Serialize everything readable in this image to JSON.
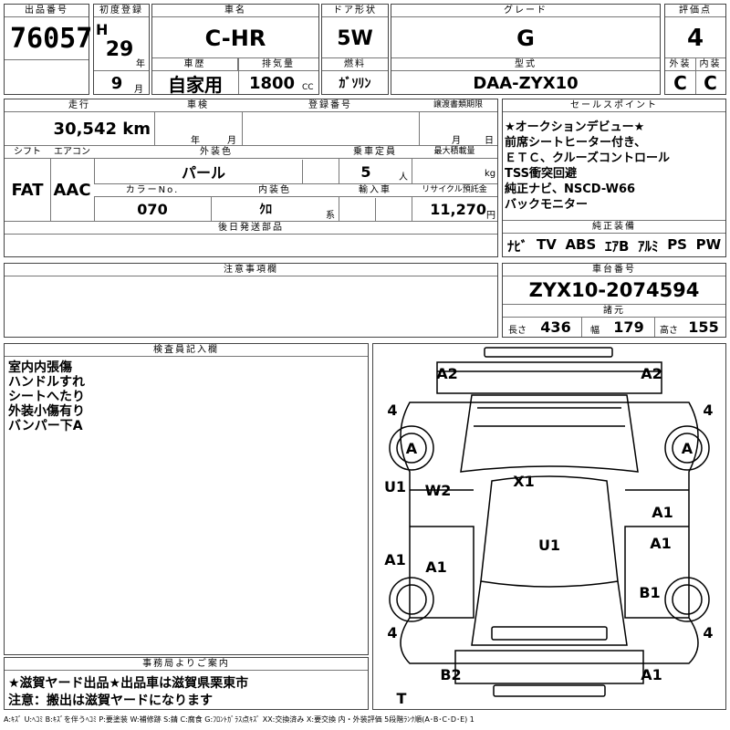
{
  "header": {
    "lot_no_label": "出品番号",
    "lot_no": "76057",
    "first_reg_label": "初度登録",
    "era": "H",
    "year": "29",
    "year_unit": "年",
    "month": "9",
    "month_unit": "月",
    "name_label": "車名",
    "name": "C-HR",
    "history_label": "車歴",
    "history": "自家用",
    "displacement_label": "排気量",
    "displacement": "1800",
    "displacement_unit": "CC",
    "door_label": "ドア形状",
    "door": "5W",
    "fuel_label": "燃料",
    "fuel": "ｶﾞｿﾘﾝ",
    "grade_label": "グレード",
    "grade": "G",
    "model_label": "型式",
    "model": "DAA-ZYX10",
    "score_label": "評価点",
    "score": "4",
    "ext_label": "外装",
    "ext": "C",
    "int_label": "内装",
    "int": "C"
  },
  "row2": {
    "mileage_label": "走行",
    "mileage": "30,542 km",
    "inspection_label": "車検",
    "insp_year_unit": "年",
    "insp_month_unit": "月",
    "reg_no_label": "登録番号",
    "transfer_label": "譲渡書類期限",
    "transfer_month_unit": "月",
    "transfer_day_unit": "日",
    "shift_label": "シフト",
    "shift": "FAT",
    "ac_label": "エアコン",
    "ac": "AAC",
    "color_label": "外装色",
    "color": "パール",
    "capacity_label": "乗車定員",
    "capacity": "5",
    "capacity_unit": "人",
    "load_label": "最大積載量",
    "load_unit": "kg",
    "color_no_label": "カラーNo.",
    "color_no": "070",
    "interior_color_label": "内装色",
    "interior_color": "ｸﾛ",
    "interior_unit": "系",
    "import_label": "輸入車",
    "recycle_label": "リサイクル預託金",
    "recycle": "11,270",
    "recycle_unit": "円",
    "later_parts_label": "後日発送部品"
  },
  "selling": {
    "label": "セールスポイント",
    "lines": [
      "★オークションデビュー★",
      "前席シートヒーター付き、",
      "ＥＴＣ、クルーズコントロール",
      "TSS衝突回避",
      "純正ナビ、NSCD-W66",
      "バックモニター"
    ]
  },
  "equipment": {
    "label": "純正装備",
    "items": [
      "ﾅﾋﾞ",
      "TV",
      "ABS",
      "ｴｱB",
      "ｱﾙﾐ",
      "PS",
      "PW"
    ]
  },
  "caution": {
    "label": "注意事項欄"
  },
  "chassis": {
    "label": "車台番号",
    "value": "ZYX10-2074594",
    "spec_label": "諸元",
    "length_label": "長さ",
    "length": "436",
    "width_label": "幅",
    "width": "179",
    "height_label": "高さ",
    "height": "155"
  },
  "inspector": {
    "label": "検査員記入欄",
    "notes": [
      "室内内張傷",
      "ハンドルすれ",
      "シートへたり",
      "外装小傷有り",
      "バンパー下A"
    ]
  },
  "office": {
    "label": "事務局よりご案内",
    "line1": "★滋賀ヤード出品★出品車は滋賀県栗東市",
    "line2": "注意：搬出は滋賀ヤードになります"
  },
  "diagram": {
    "marks": {
      "a2_left": "A2",
      "a2_right": "A2",
      "tire_fl": "4",
      "tire_fr": "4",
      "tire_rl": "4",
      "tire_rr": "4",
      "spare": "T",
      "wheel_fl": "A",
      "wheel_fr": "A",
      "u1_left": "U1",
      "w2": "W2",
      "x1": "X1",
      "a1_rdoor": "A1",
      "u1_roof": "U1",
      "a1_lfender": "A1",
      "a1_ldoor": "A1",
      "a1_rside": "A1",
      "b1": "B1",
      "b2": "B2",
      "a1_rear": "A1"
    }
  },
  "legend": "A:ｷｽﾞ U:ﾍｺﾐ B:ｷｽﾞを伴うﾍｺﾐ P:要塗装 W:補修跡 S:錆 C:腐食 G:ﾌﾛﾝﾄｶﾞﾗｽ点ｷｽﾞ XX:交換済み X:要交換 内・外装評価 5段階ﾗﾝｸ順(A･B･C･D･E) 1"
}
